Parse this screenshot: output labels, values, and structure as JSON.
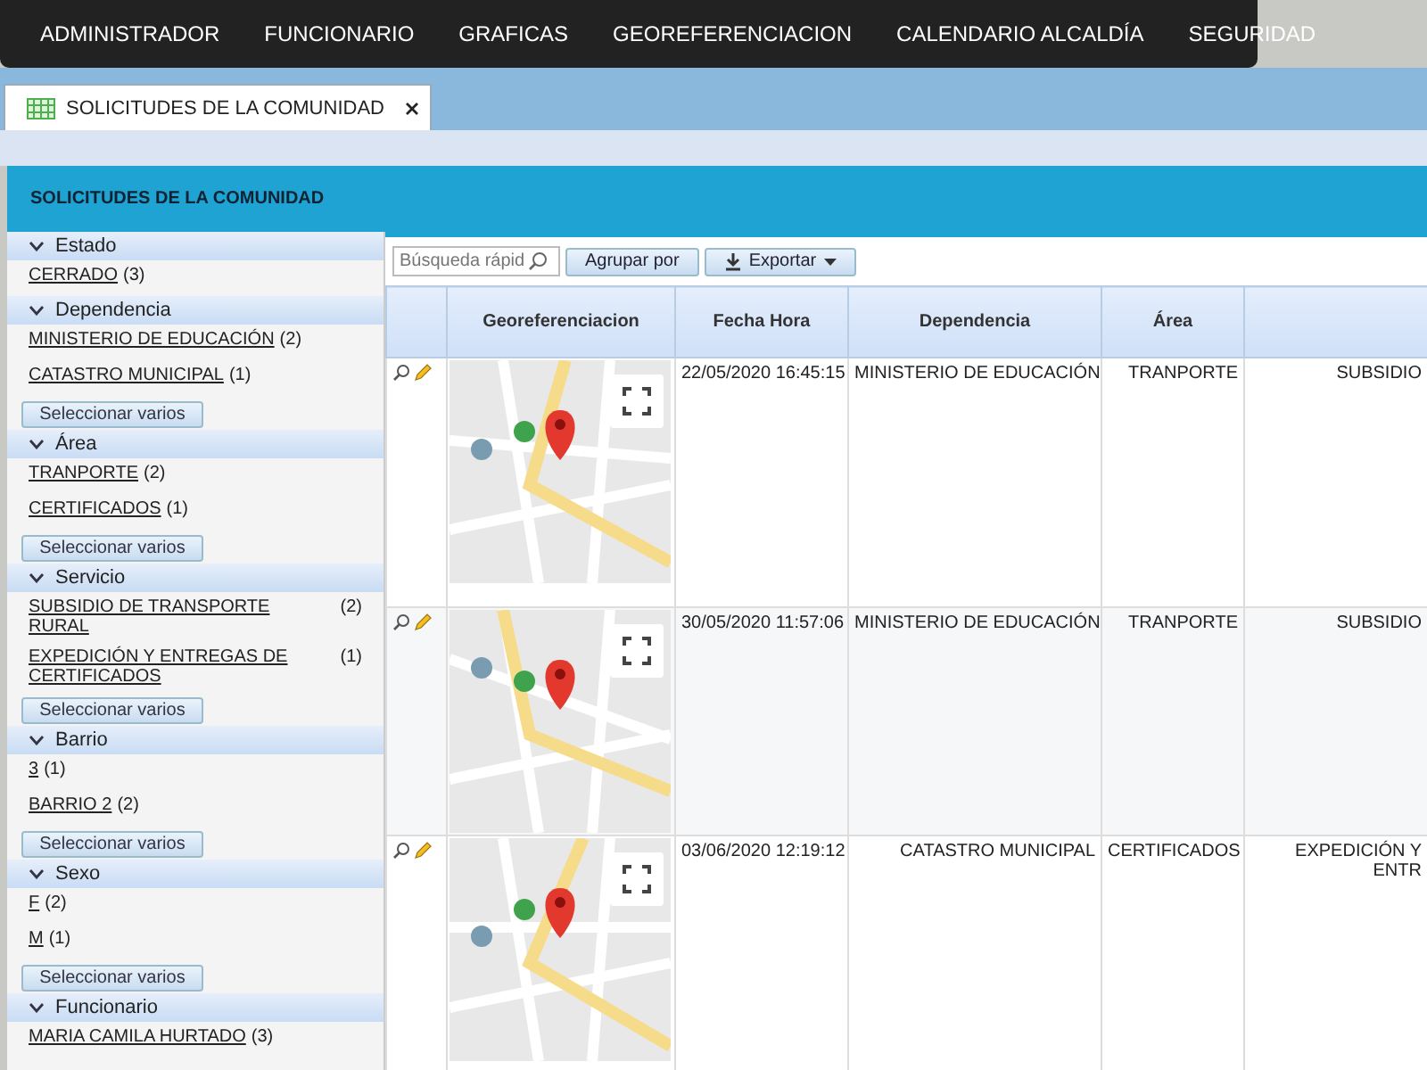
{
  "nav": {
    "items": [
      "ADMINISTRADOR",
      "FUNCIONARIO",
      "GRAFICAS",
      "GEOREFERENCIACION",
      "CALENDARIO ALCALDÍA",
      "SEGURIDAD"
    ]
  },
  "tabs": [
    {
      "label": "SOLICITUDES DE LA COMUNIDAD",
      "selected": true
    }
  ],
  "panel": {
    "title": "SOLICITUDES DE LA COMUNIDAD"
  },
  "filters": [
    {
      "title": "Estado",
      "expanded": true,
      "items": [
        {
          "label": "CERRADO",
          "count": "(3)"
        }
      ]
    },
    {
      "title": "Dependencia",
      "expanded": true,
      "items": [
        {
          "label": "MINISTERIO DE EDUCACIÓN",
          "count": "(2)"
        },
        {
          "label": "CATASTRO MUNICIPAL",
          "count": "(1)"
        }
      ],
      "button": "Seleccionar varios"
    },
    {
      "title": "Área",
      "expanded": true,
      "items": [
        {
          "label": "TRANPORTE",
          "count": "(2)"
        },
        {
          "label": "CERTIFICADOS",
          "count": "(1)"
        }
      ],
      "button": "Seleccionar varios"
    },
    {
      "title": "Servicio",
      "expanded": true,
      "items": [
        {
          "label": "SUBSIDIO DE TRANSPORTE RURAL",
          "count": "(2)"
        },
        {
          "label": "EXPEDICIÓN Y ENTREGAS DE CERTIFICADOS",
          "count": "(1)"
        }
      ],
      "button": "Seleccionar varios"
    },
    {
      "title": "Barrio",
      "expanded": true,
      "items": [
        {
          "label": "3",
          "count": "(1)"
        },
        {
          "label": "BARRIO 2",
          "count": "(2)"
        }
      ],
      "button": "Seleccionar varios"
    },
    {
      "title": "Sexo",
      "expanded": true,
      "items": [
        {
          "label": "F",
          "count": "(2)"
        },
        {
          "label": "M",
          "count": "(1)"
        }
      ],
      "button": "Seleccionar varios"
    },
    {
      "title": "Funcionario",
      "expanded": true,
      "items": [
        {
          "label": "MARIA CAMILA HURTADO",
          "count": "(3)"
        }
      ]
    }
  ],
  "toolbar": {
    "search": {
      "placeholder": "Búsqueda rápid"
    },
    "buttons": [
      {
        "label": "Agrupar por",
        "kind": "plain"
      },
      {
        "label": "Exportar",
        "kind": "export"
      }
    ]
  },
  "table": {
    "columns": [
      "Georeferenciacion",
      "Fecha Hora",
      "Dependencia",
      "Área"
    ],
    "rows": [
      {
        "fecha_hora": "22/05/2020 16:45:15",
        "dependencia": "MINISTERIO DE EDUCACIÓN",
        "area": "TRANPORTE",
        "column_6": "SUBSIDIO"
      },
      {
        "fecha_hora": "30/05/2020 11:57:06",
        "dependencia": "MINISTERIO DE EDUCACIÓN",
        "area": "TRANPORTE",
        "column_6": "SUBSIDIO"
      },
      {
        "fecha_hora": "03/06/2020 12:19:12",
        "dependencia": "CATASTRO MUNICIPAL",
        "area": "CERTIFICADOS",
        "column_6": "EXPEDICIÓN Y ENTR"
      }
    ]
  }
}
